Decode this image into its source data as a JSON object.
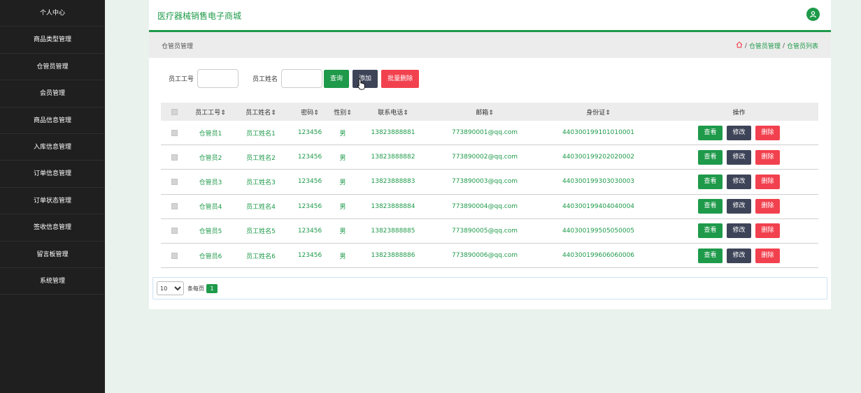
{
  "sidebar": {
    "items": [
      {
        "label": "个人中心"
      },
      {
        "label": "商品类型管理"
      },
      {
        "label": "仓管员管理"
      },
      {
        "label": "会员管理"
      },
      {
        "label": "商品信息管理"
      },
      {
        "label": "入库信息管理"
      },
      {
        "label": "订单信息管理"
      },
      {
        "label": "订单状态管理"
      },
      {
        "label": "签收信息管理"
      },
      {
        "label": "留言板管理"
      },
      {
        "label": "系统管理"
      }
    ]
  },
  "header": {
    "title": "医疗器械销售电子商城",
    "user_icon": "user-icon",
    "accent": "#1e9a4a"
  },
  "breadcrumb": {
    "page_title": "仓管员管理",
    "home_icon": "home-icon",
    "sep": "/",
    "items": [
      "仓管员管理",
      "仓管员列表"
    ]
  },
  "search": {
    "emp_no_label": "员工工号",
    "emp_no_value": "",
    "emp_name_label": "员工姓名",
    "emp_name_value": "",
    "query_label": "查询",
    "add_label": "添加",
    "batch_delete_label": "批量删除"
  },
  "table": {
    "columns": [
      "员工工号",
      "员工姓名",
      "密码",
      "性别",
      "联系电话",
      "邮箱",
      "身份证",
      "操作"
    ],
    "sort_glyph": "⇕",
    "rows": [
      {
        "emp_no": "仓管员1",
        "name": "员工姓名1",
        "password": "123456",
        "gender": "男",
        "phone": "13823888881",
        "email": "773890001@qq.com",
        "id_card": "440300199101010001"
      },
      {
        "emp_no": "仓管员2",
        "name": "员工姓名2",
        "password": "123456",
        "gender": "男",
        "phone": "13823888882",
        "email": "773890002@qq.com",
        "id_card": "440300199202020002"
      },
      {
        "emp_no": "仓管员3",
        "name": "员工姓名3",
        "password": "123456",
        "gender": "男",
        "phone": "13823888883",
        "email": "773890003@qq.com",
        "id_card": "440300199303030003"
      },
      {
        "emp_no": "仓管员4",
        "name": "员工姓名4",
        "password": "123456",
        "gender": "男",
        "phone": "13823888884",
        "email": "773890004@qq.com",
        "id_card": "440300199404040004"
      },
      {
        "emp_no": "仓管员5",
        "name": "员工姓名5",
        "password": "123456",
        "gender": "男",
        "phone": "13823888885",
        "email": "773890005@qq.com",
        "id_card": "440300199505050005"
      },
      {
        "emp_no": "仓管员6",
        "name": "员工姓名6",
        "password": "123456",
        "gender": "男",
        "phone": "13823888886",
        "email": "773890006@qq.com",
        "id_card": "440300199606060006"
      }
    ],
    "actions": {
      "view": "查看",
      "edit": "修改",
      "delete": "删除"
    }
  },
  "pagination": {
    "page_size": "10",
    "page_size_suffix": "条每页",
    "current_page": "1"
  }
}
